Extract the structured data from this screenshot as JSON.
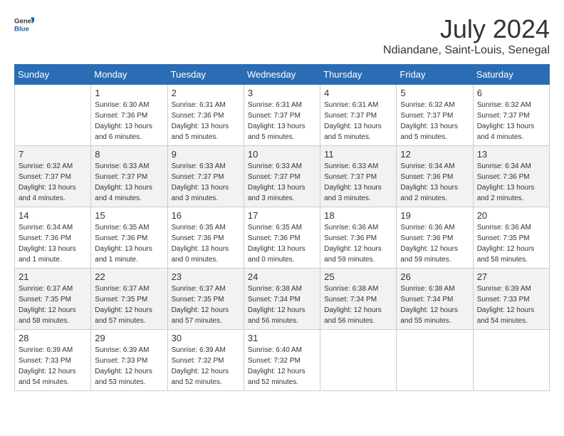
{
  "header": {
    "logo_general": "General",
    "logo_blue": "Blue",
    "month_year": "July 2024",
    "location": "Ndiandane, Saint-Louis, Senegal"
  },
  "weekdays": [
    "Sunday",
    "Monday",
    "Tuesday",
    "Wednesday",
    "Thursday",
    "Friday",
    "Saturday"
  ],
  "weeks": [
    [
      {
        "day": "",
        "sunrise": "",
        "sunset": "",
        "daylight": ""
      },
      {
        "day": "1",
        "sunrise": "Sunrise: 6:30 AM",
        "sunset": "Sunset: 7:36 PM",
        "daylight": "Daylight: 13 hours and 6 minutes."
      },
      {
        "day": "2",
        "sunrise": "Sunrise: 6:31 AM",
        "sunset": "Sunset: 7:36 PM",
        "daylight": "Daylight: 13 hours and 5 minutes."
      },
      {
        "day": "3",
        "sunrise": "Sunrise: 6:31 AM",
        "sunset": "Sunset: 7:37 PM",
        "daylight": "Daylight: 13 hours and 5 minutes."
      },
      {
        "day": "4",
        "sunrise": "Sunrise: 6:31 AM",
        "sunset": "Sunset: 7:37 PM",
        "daylight": "Daylight: 13 hours and 5 minutes."
      },
      {
        "day": "5",
        "sunrise": "Sunrise: 6:32 AM",
        "sunset": "Sunset: 7:37 PM",
        "daylight": "Daylight: 13 hours and 5 minutes."
      },
      {
        "day": "6",
        "sunrise": "Sunrise: 6:32 AM",
        "sunset": "Sunset: 7:37 PM",
        "daylight": "Daylight: 13 hours and 4 minutes."
      }
    ],
    [
      {
        "day": "7",
        "sunrise": "Sunrise: 6:32 AM",
        "sunset": "Sunset: 7:37 PM",
        "daylight": "Daylight: 13 hours and 4 minutes."
      },
      {
        "day": "8",
        "sunrise": "Sunrise: 6:33 AM",
        "sunset": "Sunset: 7:37 PM",
        "daylight": "Daylight: 13 hours and 4 minutes."
      },
      {
        "day": "9",
        "sunrise": "Sunrise: 6:33 AM",
        "sunset": "Sunset: 7:37 PM",
        "daylight": "Daylight: 13 hours and 3 minutes."
      },
      {
        "day": "10",
        "sunrise": "Sunrise: 6:33 AM",
        "sunset": "Sunset: 7:37 PM",
        "daylight": "Daylight: 13 hours and 3 minutes."
      },
      {
        "day": "11",
        "sunrise": "Sunrise: 6:33 AM",
        "sunset": "Sunset: 7:37 PM",
        "daylight": "Daylight: 13 hours and 3 minutes."
      },
      {
        "day": "12",
        "sunrise": "Sunrise: 6:34 AM",
        "sunset": "Sunset: 7:36 PM",
        "daylight": "Daylight: 13 hours and 2 minutes."
      },
      {
        "day": "13",
        "sunrise": "Sunrise: 6:34 AM",
        "sunset": "Sunset: 7:36 PM",
        "daylight": "Daylight: 13 hours and 2 minutes."
      }
    ],
    [
      {
        "day": "14",
        "sunrise": "Sunrise: 6:34 AM",
        "sunset": "Sunset: 7:36 PM",
        "daylight": "Daylight: 13 hours and 1 minute."
      },
      {
        "day": "15",
        "sunrise": "Sunrise: 6:35 AM",
        "sunset": "Sunset: 7:36 PM",
        "daylight": "Daylight: 13 hours and 1 minute."
      },
      {
        "day": "16",
        "sunrise": "Sunrise: 6:35 AM",
        "sunset": "Sunset: 7:36 PM",
        "daylight": "Daylight: 13 hours and 0 minutes."
      },
      {
        "day": "17",
        "sunrise": "Sunrise: 6:35 AM",
        "sunset": "Sunset: 7:36 PM",
        "daylight": "Daylight: 13 hours and 0 minutes."
      },
      {
        "day": "18",
        "sunrise": "Sunrise: 6:36 AM",
        "sunset": "Sunset: 7:36 PM",
        "daylight": "Daylight: 12 hours and 59 minutes."
      },
      {
        "day": "19",
        "sunrise": "Sunrise: 6:36 AM",
        "sunset": "Sunset: 7:36 PM",
        "daylight": "Daylight: 12 hours and 59 minutes."
      },
      {
        "day": "20",
        "sunrise": "Sunrise: 6:36 AM",
        "sunset": "Sunset: 7:35 PM",
        "daylight": "Daylight: 12 hours and 58 minutes."
      }
    ],
    [
      {
        "day": "21",
        "sunrise": "Sunrise: 6:37 AM",
        "sunset": "Sunset: 7:35 PM",
        "daylight": "Daylight: 12 hours and 58 minutes."
      },
      {
        "day": "22",
        "sunrise": "Sunrise: 6:37 AM",
        "sunset": "Sunset: 7:35 PM",
        "daylight": "Daylight: 12 hours and 57 minutes."
      },
      {
        "day": "23",
        "sunrise": "Sunrise: 6:37 AM",
        "sunset": "Sunset: 7:35 PM",
        "daylight": "Daylight: 12 hours and 57 minutes."
      },
      {
        "day": "24",
        "sunrise": "Sunrise: 6:38 AM",
        "sunset": "Sunset: 7:34 PM",
        "daylight": "Daylight: 12 hours and 56 minutes."
      },
      {
        "day": "25",
        "sunrise": "Sunrise: 6:38 AM",
        "sunset": "Sunset: 7:34 PM",
        "daylight": "Daylight: 12 hours and 56 minutes."
      },
      {
        "day": "26",
        "sunrise": "Sunrise: 6:38 AM",
        "sunset": "Sunset: 7:34 PM",
        "daylight": "Daylight: 12 hours and 55 minutes."
      },
      {
        "day": "27",
        "sunrise": "Sunrise: 6:39 AM",
        "sunset": "Sunset: 7:33 PM",
        "daylight": "Daylight: 12 hours and 54 minutes."
      }
    ],
    [
      {
        "day": "28",
        "sunrise": "Sunrise: 6:39 AM",
        "sunset": "Sunset: 7:33 PM",
        "daylight": "Daylight: 12 hours and 54 minutes."
      },
      {
        "day": "29",
        "sunrise": "Sunrise: 6:39 AM",
        "sunset": "Sunset: 7:33 PM",
        "daylight": "Daylight: 12 hours and 53 minutes."
      },
      {
        "day": "30",
        "sunrise": "Sunrise: 6:39 AM",
        "sunset": "Sunset: 7:32 PM",
        "daylight": "Daylight: 12 hours and 52 minutes."
      },
      {
        "day": "31",
        "sunrise": "Sunrise: 6:40 AM",
        "sunset": "Sunset: 7:32 PM",
        "daylight": "Daylight: 12 hours and 52 minutes."
      },
      {
        "day": "",
        "sunrise": "",
        "sunset": "",
        "daylight": ""
      },
      {
        "day": "",
        "sunrise": "",
        "sunset": "",
        "daylight": ""
      },
      {
        "day": "",
        "sunrise": "",
        "sunset": "",
        "daylight": ""
      }
    ]
  ]
}
